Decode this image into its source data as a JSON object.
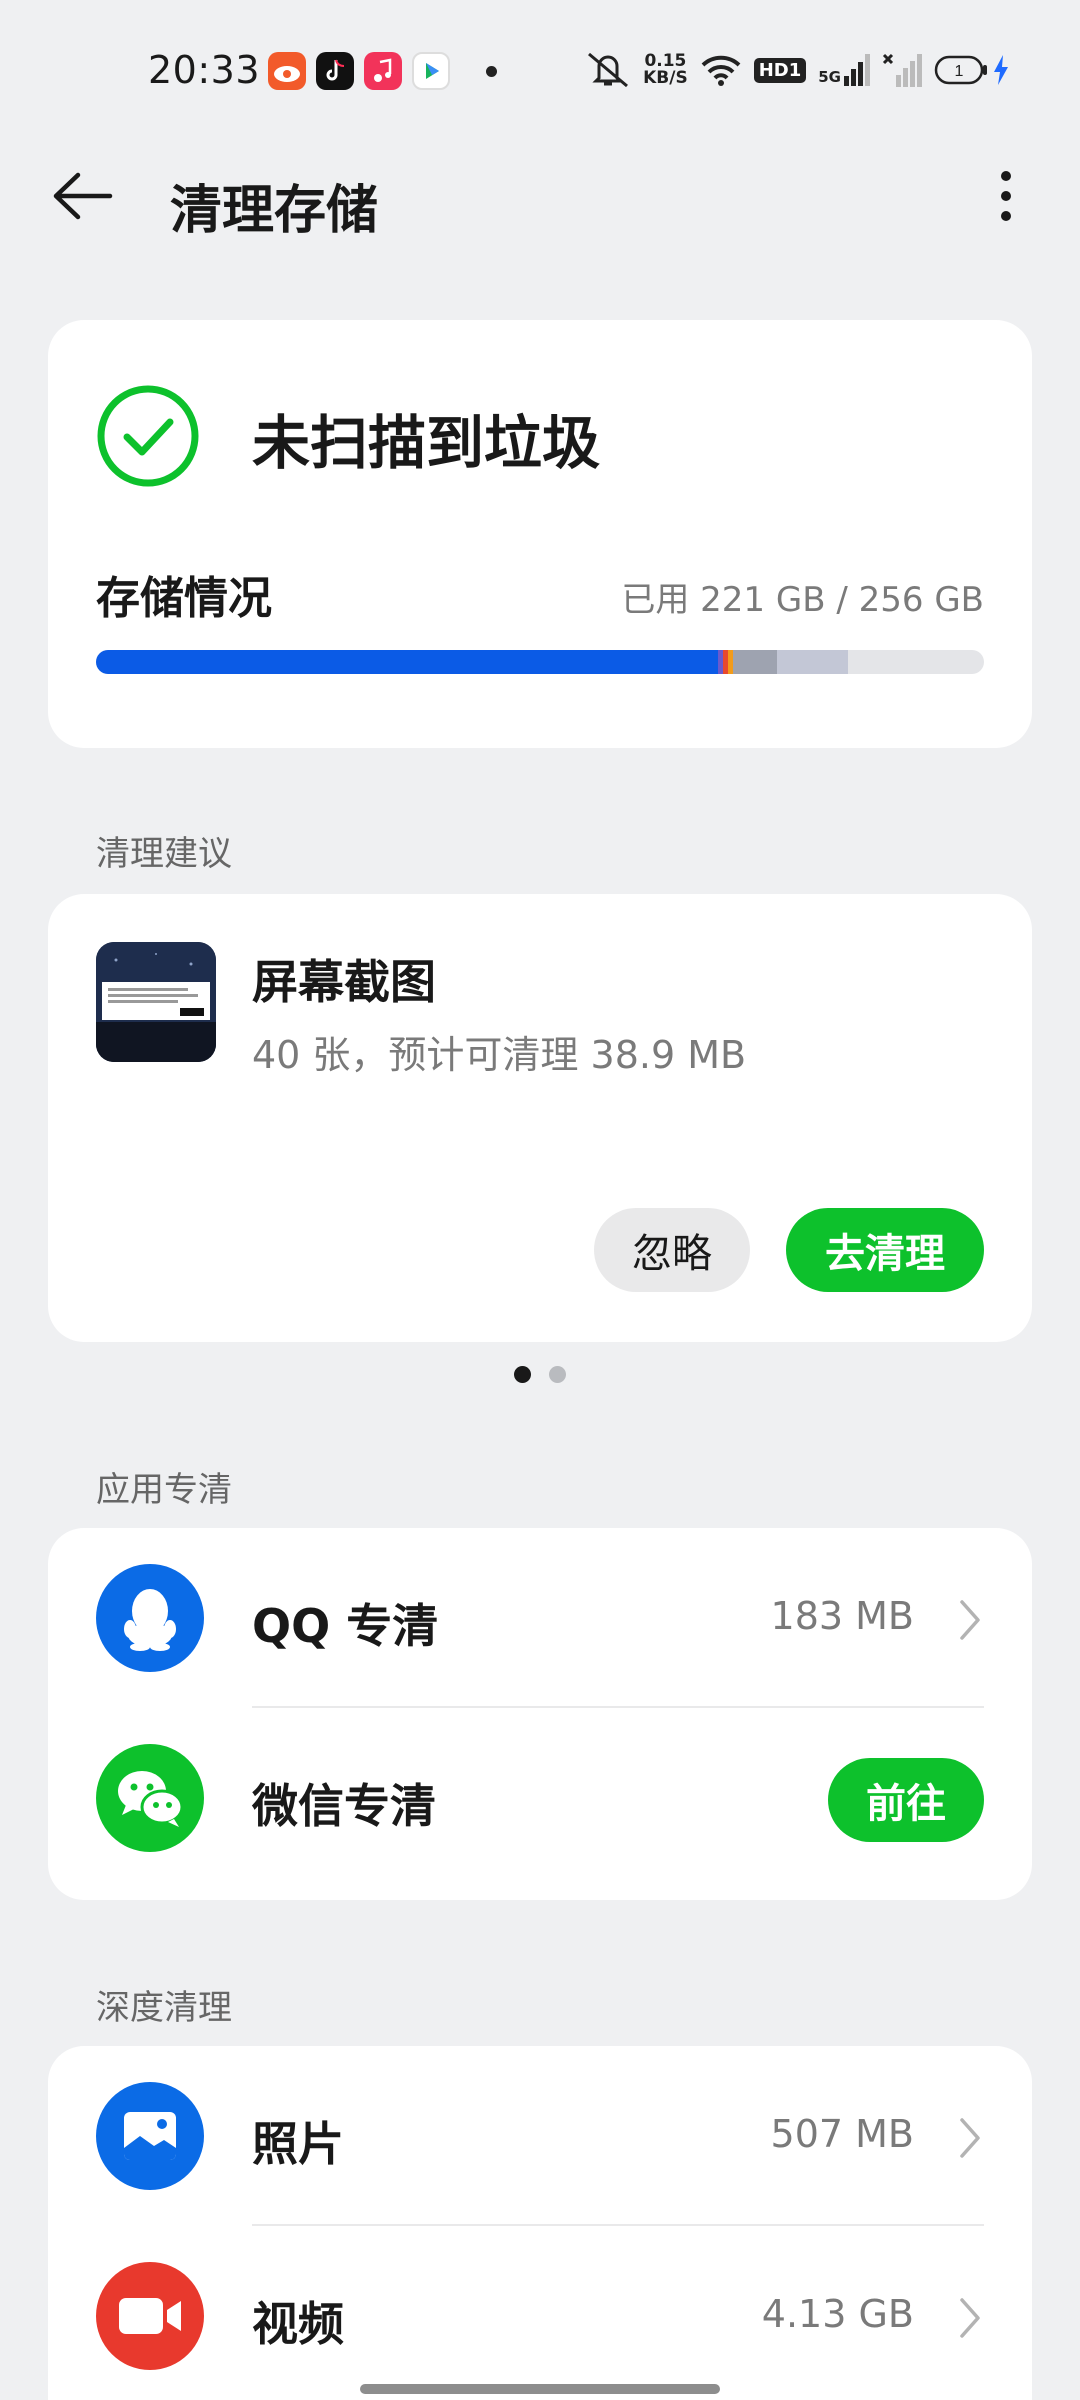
{
  "status_bar": {
    "time": "20:33",
    "net_speed_value": "0.15",
    "net_speed_unit": "KB/S",
    "hd_label": "HD1",
    "network_label": "5G",
    "battery_label": "1"
  },
  "header": {
    "title": "清理存储"
  },
  "scan_card": {
    "status": "未扫描到垃圾",
    "storage_label": "存储情况",
    "storage_usage": "已用 221 GB / 256 GB",
    "segments": [
      {
        "fraction": 0.7,
        "color": "#0b5be6"
      },
      {
        "fraction": 0.006,
        "color": "#6a5acd"
      },
      {
        "fraction": 0.006,
        "color": "#e8492d"
      },
      {
        "fraction": 0.005,
        "color": "#f29b1b"
      },
      {
        "fraction": 0.05,
        "color": "#9ea3b0"
      },
      {
        "fraction": 0.08,
        "color": "#c3c7d6"
      }
    ]
  },
  "suggest_section": {
    "title": "清理建议",
    "item_title": "屏幕截图",
    "item_sub": "40 张，预计可清理 38.9 MB",
    "ignore_label": "忽略",
    "clean_label": "去清理",
    "pages": 2,
    "active_page": 0
  },
  "apps_section": {
    "title": "应用专清",
    "items": [
      {
        "label": "QQ 专清",
        "value": "183 MB"
      },
      {
        "label": "微信专清",
        "action": "前往"
      }
    ]
  },
  "deep_section": {
    "title": "深度清理",
    "items": [
      {
        "label": "照片",
        "value": "507 MB"
      },
      {
        "label": "视频",
        "value": "4.13 GB"
      }
    ]
  },
  "colors": {
    "accent_green": "#0dc12c",
    "blue": "#0b5be6",
    "red": "#e8392d"
  }
}
